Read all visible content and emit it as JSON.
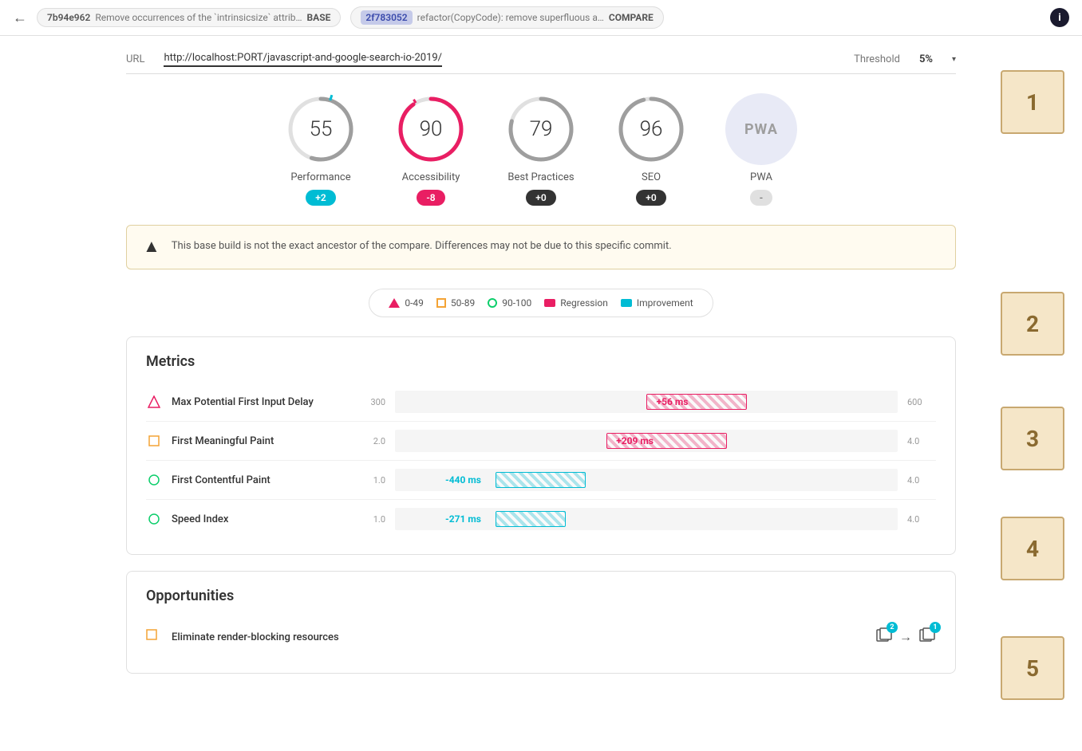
{
  "topbar": {
    "back_label": "←",
    "base_hash": "7b94e962",
    "base_msg": "Remove occurrences of the `intrinsicsize` attrib…",
    "base_tag": "BASE",
    "compare_hash": "2f783052",
    "compare_msg": "refactor(CopyCode): remove superfluous a…",
    "compare_tag": "COMPARE",
    "info_icon": "i"
  },
  "urlbar": {
    "url_label": "URL",
    "url_value": "http://localhost:PORT/javascript-and-google-search-io-2019/",
    "threshold_label": "Threshold",
    "threshold_value": "5%"
  },
  "scores": [
    {
      "id": "performance",
      "value": 55,
      "label": "Performance",
      "badge": "+2",
      "badge_type": "improvement",
      "circle_color": "#00bcd4",
      "ring_color": "#9e9e9e",
      "ring_pct": 55,
      "has_tick": true,
      "tick_color": "#00bcd4"
    },
    {
      "id": "accessibility",
      "value": 90,
      "label": "Accessibility",
      "badge": "-8",
      "badge_type": "regression",
      "ring_color": "#e91e63",
      "ring_pct": 90,
      "has_tick": true,
      "tick_color": "#e91e63"
    },
    {
      "id": "best-practices",
      "value": 79,
      "label": "Best Practices",
      "badge": "+0",
      "badge_type": "neutral",
      "ring_color": "#9e9e9e",
      "ring_pct": 79
    },
    {
      "id": "seo",
      "value": 96,
      "label": "SEO",
      "badge": "+0",
      "badge_type": "neutral",
      "ring_color": "#9e9e9e",
      "ring_pct": 96
    },
    {
      "id": "pwa",
      "value": "PWA",
      "label": "PWA",
      "badge": "-",
      "badge_type": "dash"
    }
  ],
  "warning": {
    "icon": "▲",
    "text": "This base build is not the exact ancestor of the compare. Differences may not be due to this specific commit."
  },
  "legend": {
    "items": [
      {
        "shape": "triangle",
        "label": "0-49"
      },
      {
        "shape": "square-orange",
        "label": "50-89"
      },
      {
        "shape": "circle-green",
        "label": "90-100"
      },
      {
        "shape": "rect-pink",
        "label": "Regression"
      },
      {
        "shape": "rect-cyan",
        "label": "Improvement"
      }
    ]
  },
  "metrics": {
    "title": "Metrics",
    "rows": [
      {
        "icon": "triangle",
        "icon_color": "#e91e63",
        "name": "Max Potential First Input Delay",
        "min": "300",
        "max": "600",
        "bar_type": "hatch-pink",
        "bar_left_pct": 50,
        "bar_width_pct": 18,
        "label": "+56 ms",
        "label_color": "pink"
      },
      {
        "icon": "square",
        "icon_color": "#f4a335",
        "name": "First Meaningful Paint",
        "min": "2.0",
        "max": "4.0",
        "bar_type": "hatch-pink",
        "bar_left_pct": 45,
        "bar_width_pct": 22,
        "label": "+209 ms",
        "label_color": "pink"
      },
      {
        "icon": "circle",
        "icon_color": "#0cce6b",
        "name": "First Contentful Paint",
        "min": "1.0",
        "max": "4.0",
        "bar_type": "hatch-cyan",
        "bar_left_pct": 22,
        "bar_width_pct": 18,
        "label": "-440 ms",
        "label_color": "cyan"
      },
      {
        "icon": "circle",
        "icon_color": "#0cce6b",
        "name": "Speed Index",
        "min": "1.0",
        "max": "4.0",
        "bar_type": "hatch-cyan",
        "bar_left_pct": 22,
        "bar_width_pct": 14,
        "label": "-271 ms",
        "label_color": "cyan"
      }
    ]
  },
  "opportunities": {
    "title": "Opportunities",
    "rows": [
      {
        "icon": "square",
        "icon_color": "#f4a335",
        "name": "Eliminate render-blocking resources",
        "base_count": 2,
        "compare_count": 1
      }
    ]
  },
  "annotations": [
    {
      "id": "1",
      "label": "1"
    },
    {
      "id": "2",
      "label": "2"
    },
    {
      "id": "3",
      "label": "3"
    },
    {
      "id": "4",
      "label": "4"
    },
    {
      "id": "5",
      "label": "5"
    }
  ]
}
